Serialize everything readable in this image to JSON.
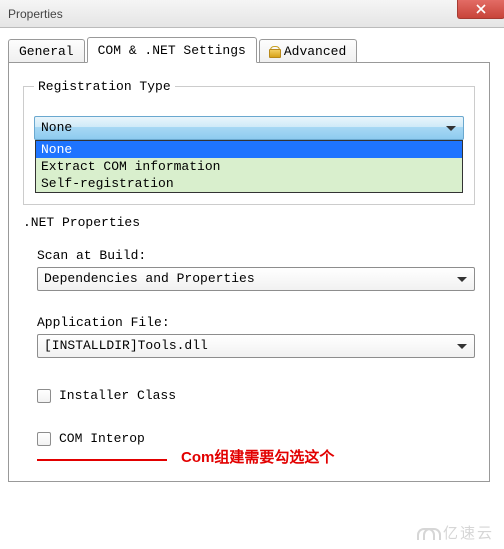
{
  "window": {
    "title": "Properties"
  },
  "tabs": {
    "general": "General",
    "com": "COM & .NET Settings",
    "advanced": "Advanced"
  },
  "registration": {
    "legend": "Registration Type",
    "selected": "None",
    "options": [
      "None",
      "Extract COM information",
      "Self-registration"
    ]
  },
  "net": {
    "heading": ".NET Properties",
    "scan_label": "Scan at Build:",
    "scan_value": "Dependencies and Properties",
    "appfile_label": "Application File:",
    "appfile_value": "[INSTALLDIR]Tools.dll",
    "installer_class": "Installer Class",
    "com_interop": "COM Interop"
  },
  "annotation": "Com组建需要勾选这个",
  "watermark": "亿速云"
}
